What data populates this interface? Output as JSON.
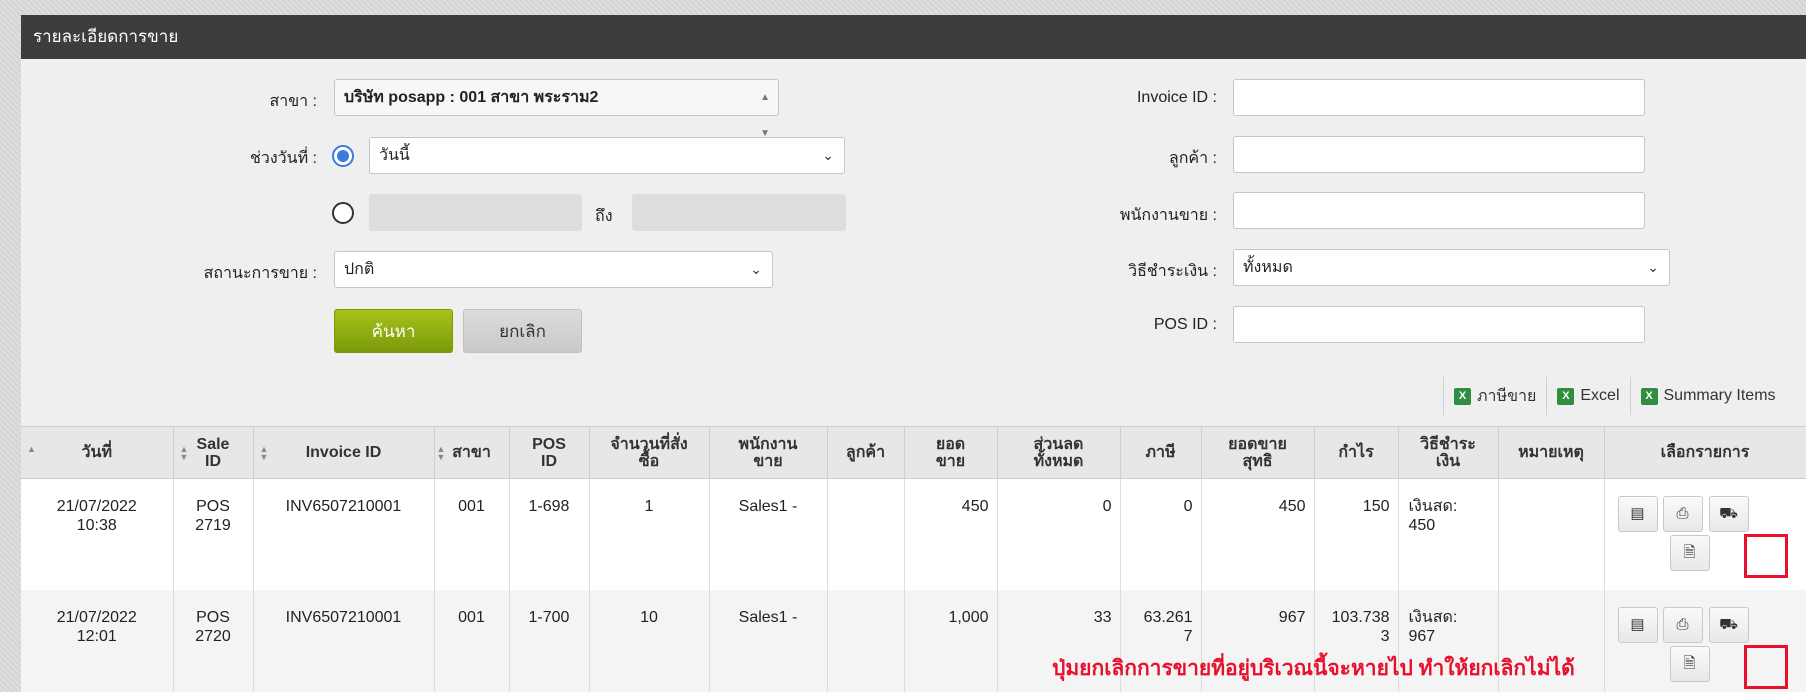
{
  "panel": {
    "title": "รายละเอียดการขาย"
  },
  "filters": {
    "branch_label": "สาขา :",
    "branch_value": "บริษัท posapp : 001 สาขา พระราม2",
    "daterange_label": "ช่วงวันที่ :",
    "daterange_preset": "วันนี้",
    "daterange_to": "ถึง",
    "status_label": "สถานะการขาย :",
    "status_value": "ปกติ",
    "invoice_label": "Invoice ID :",
    "customer_label": "ลูกค้า :",
    "salesperson_label": "พนักงานขาย :",
    "payment_label": "วิธีชำระเงิน :",
    "payment_value": "ทั้งหมด",
    "pos_label": "POS ID :",
    "search_button": "ค้นหา",
    "cancel_button": "ยกเลิก"
  },
  "exports": {
    "tax": "ภาษีขาย",
    "excel": "Excel",
    "summary": "Summary Items"
  },
  "table": {
    "headers": {
      "date": "วันที่",
      "sale_id": "Sale ID",
      "invoice": "Invoice ID",
      "branch": "สาขา",
      "pos": "POS ID",
      "qty": "จำนวนที่สั่งซื้อ",
      "staff": "พนักงานขาย",
      "customer": "ลูกค้า",
      "sales": "ยอดขาย",
      "discount": "ส่วนลดทั้งหมด",
      "tax": "ภาษี",
      "net": "ยอดขายสุทธิ",
      "profit": "กำไร",
      "payment": "วิธีชำระเงิน",
      "note": "หมายเหตุ",
      "action": "เลือกรายการ"
    },
    "rows": [
      {
        "date": "21/07/2022",
        "time": "10:38",
        "sale_id_a": "POS",
        "sale_id_b": "2719",
        "invoice": "INV6507210001",
        "branch": "001",
        "pos": "1-698",
        "qty": "1",
        "staff": "Sales1 -",
        "customer": "",
        "sales": "450",
        "discount": "0",
        "tax_a": "0",
        "tax_b": "",
        "net": "450",
        "profit_a": "150",
        "profit_b": "",
        "payment_a": "เงินสด:",
        "payment_b": "450",
        "note": ""
      },
      {
        "date": "21/07/2022",
        "time": "12:01",
        "sale_id_a": "POS",
        "sale_id_b": "2720",
        "invoice": "INV6507210001",
        "branch": "001",
        "pos": "1-700",
        "qty": "10",
        "staff": "Sales1 -",
        "customer": "",
        "sales": "1,000",
        "discount": "33",
        "tax_a": "63.261",
        "tax_b": "7",
        "net": "967",
        "profit_a": "103.738",
        "profit_b": "3",
        "payment_a": "เงินสด:",
        "payment_b": "967",
        "note": ""
      }
    ]
  },
  "annotation": {
    "note": "ปุ่มยกเลิกการขายที่อยู่บริเวณนี้จะหายไป ทำให้ยกเลิกไม่ได้",
    "color": "#e8112d"
  },
  "icons": {
    "detail": "list-icon",
    "print": "print-icon",
    "delivery": "truck-icon",
    "document": "document-icon",
    "excel": "excel-icon"
  }
}
